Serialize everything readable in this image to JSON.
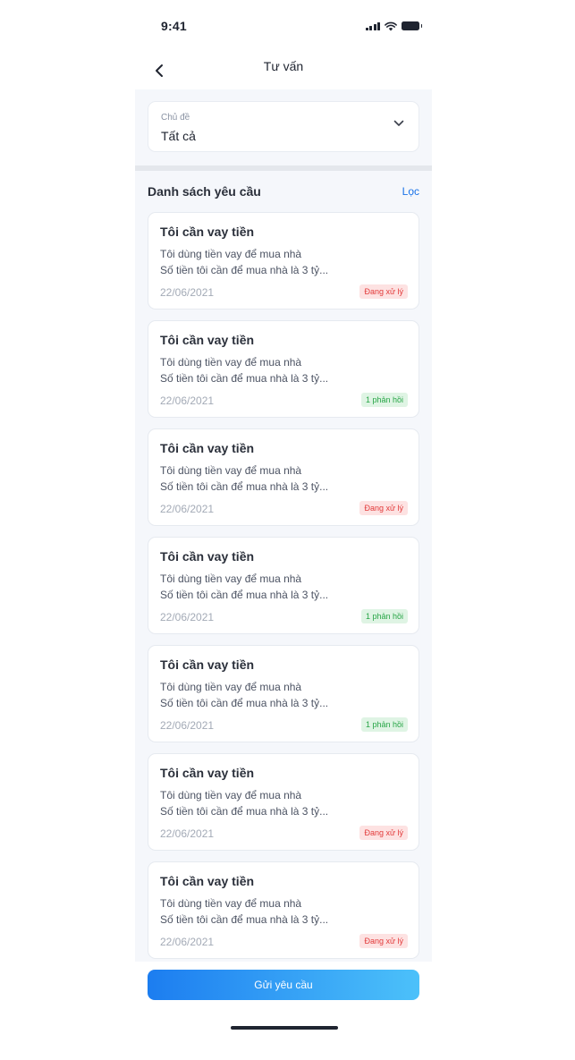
{
  "status_bar": {
    "time": "9:41"
  },
  "header": {
    "title": "Tư vấn"
  },
  "topic_select": {
    "label": "Chủ đề",
    "value": "Tất cả"
  },
  "list": {
    "title": "Danh sách yêu cầu",
    "filter_label": "Lọc",
    "items": [
      {
        "title": "Tôi cần vay tiền",
        "line1": "Tôi dùng tiền vay để mua nhà",
        "line2": "Số tiền tôi cần để mua nhà là 3 tỷ...",
        "date": "22/06/2021",
        "status": "Đang xử lý",
        "status_type": "pending"
      },
      {
        "title": "Tôi cần vay tiền",
        "line1": "Tôi dùng tiền vay để mua nhà",
        "line2": "Số tiền tôi cần để mua nhà là 3 tỷ...",
        "date": "22/06/2021",
        "status": "1 phản hồi",
        "status_type": "replied"
      },
      {
        "title": "Tôi cần vay tiền",
        "line1": "Tôi dùng tiền vay để mua nhà",
        "line2": "Số tiền tôi cần để mua nhà là 3 tỷ...",
        "date": "22/06/2021",
        "status": "Đang xử lý",
        "status_type": "pending"
      },
      {
        "title": "Tôi cần vay tiền",
        "line1": "Tôi dùng tiền vay để mua nhà",
        "line2": "Số tiền tôi cần để mua nhà là 3 tỷ...",
        "date": "22/06/2021",
        "status": "1 phản hồi",
        "status_type": "replied"
      },
      {
        "title": "Tôi cần vay tiền",
        "line1": "Tôi dùng tiền vay để mua nhà",
        "line2": "Số tiền tôi cần để mua nhà là 3 tỷ...",
        "date": "22/06/2021",
        "status": "1 phản hồi",
        "status_type": "replied"
      },
      {
        "title": "Tôi cần vay tiền",
        "line1": "Tôi dùng tiền vay để mua nhà",
        "line2": "Số tiền tôi cần để mua nhà là 3 tỷ...",
        "date": "22/06/2021",
        "status": "Đang xử lý",
        "status_type": "pending"
      },
      {
        "title": "Tôi cần vay tiền",
        "line1": "Tôi dùng tiền vay để mua nhà",
        "line2": "Số tiền tôi cần để mua nhà là 3 tỷ...",
        "date": "22/06/2021",
        "status": "Đang xử lý",
        "status_type": "pending"
      }
    ]
  },
  "footer": {
    "submit_label": "Gửi yêu cầu"
  },
  "colors": {
    "accent": "#1a73e8",
    "pending": "#e23a3a",
    "replied": "#27a546"
  }
}
